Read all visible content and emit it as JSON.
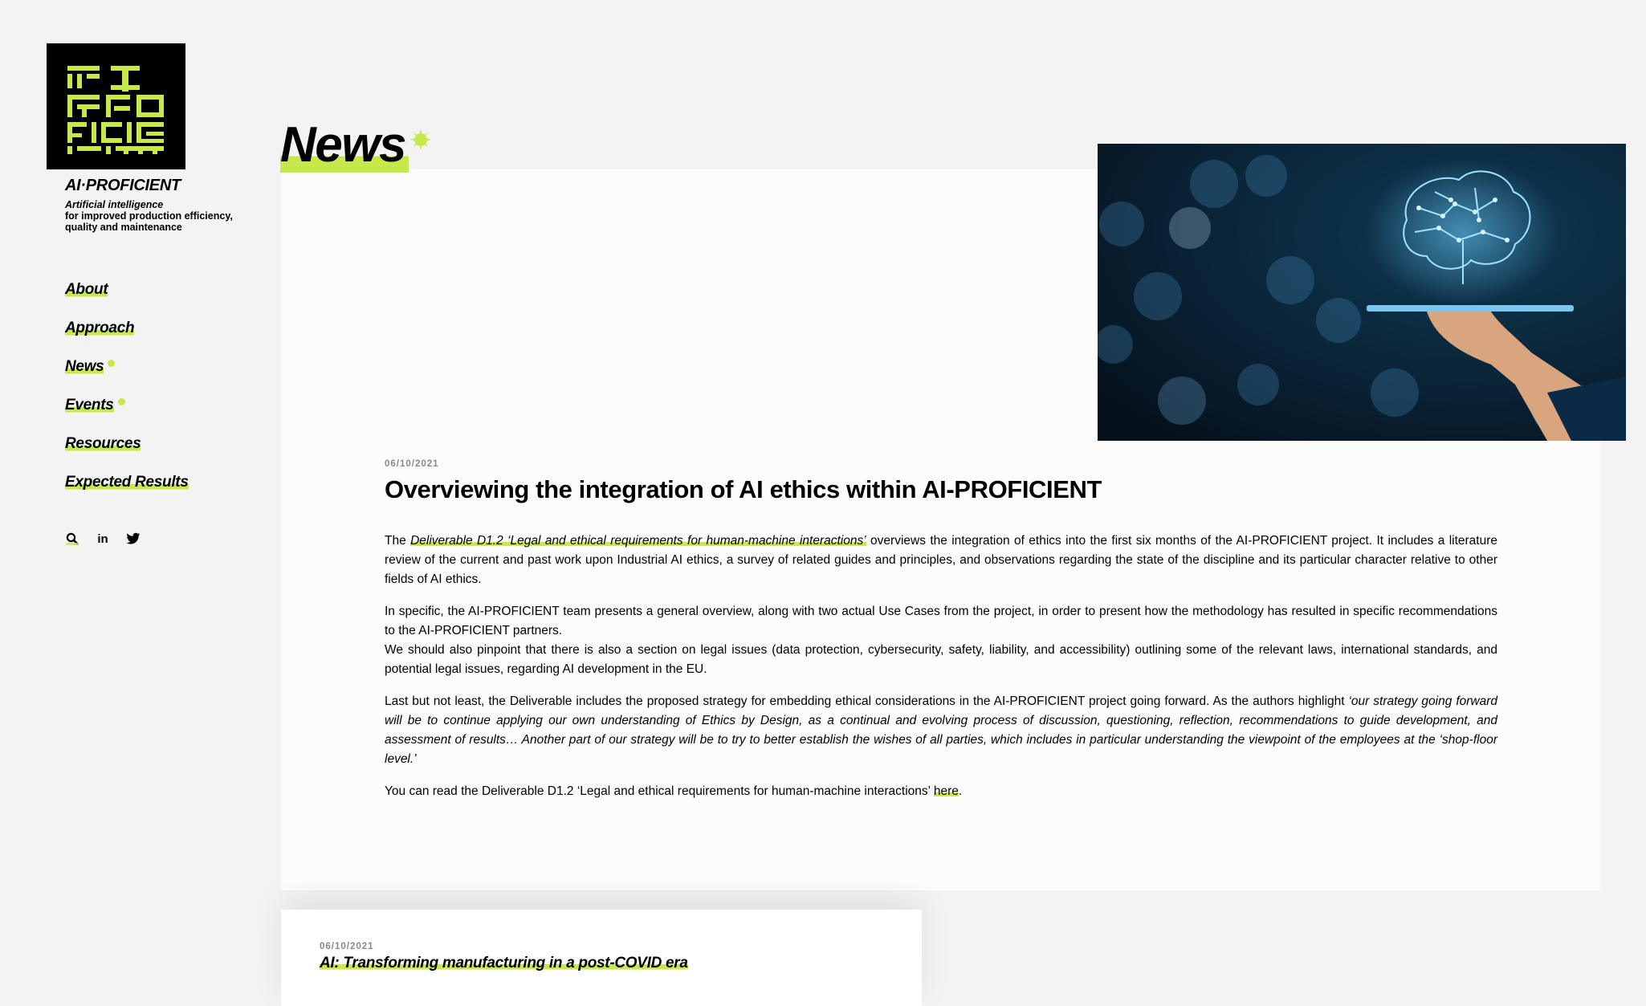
{
  "brand": {
    "name": "AI·PROFICIENT",
    "tagline_line1": "Artificial intelligence",
    "tagline_line2": "for improved production efficiency,",
    "tagline_line3": "quality and maintenance",
    "accent_color": "#c5e84a"
  },
  "nav": {
    "items": [
      {
        "label": "About"
      },
      {
        "label": "Approach"
      },
      {
        "label": "News"
      },
      {
        "label": "Events"
      },
      {
        "label": "Resources"
      },
      {
        "label": "Expected Results"
      }
    ]
  },
  "social": {
    "icons": [
      "search-icon",
      "linkedin-icon",
      "twitter-icon"
    ],
    "linkedin_label": "in"
  },
  "page": {
    "heading": "News"
  },
  "article": {
    "date": "06/10/2021",
    "title": "Overviewing the integration of AI ethics within AI-PROFICIENT",
    "p1_pre": "The ",
    "p1_link": "Deliverable D1.2 ‘Legal and ethical requirements for human-machine interactions’",
    "p1_post": " overviews the integration of ethics into the first six months of the AI-PROFICIENT project. It includes a literature review of the current and past work upon Industrial AI ethics, a survey of related guides and principles, and observations regarding the state of the discipline and its particular character relative to other fields of AI ethics.",
    "p2": "In specific, the AI-PROFICIENT team presents a general overview, along with two actual Use Cases from the project, in order to present how the methodology has resulted in specific recommendations to the AI-PROFICIENT partners.",
    "p3": "We should also pinpoint that there is also a section on legal issues (data protection, cybersecurity, safety, liability, and accessibility) outlining some of the relevant laws, international standards, and potential legal issues, regarding AI development in the EU.",
    "p4_pre": "Last but not least, the Deliverable includes the proposed strategy for embedding ethical considerations in the AI-PROFICIENT project going forward. As the authors highlight ",
    "p4_quote": "‘our strategy going forward will be to continue applying our own understanding of Ethics by Design, as a continual and evolving process of discussion, questioning, reflection, recommendations to guide development, and assessment of results… Another part of our strategy will be to try to better establish the wishes of all parties, which includes in particular understanding the viewpoint of the employees at the ‘shop-floor level.’",
    "p5_pre": "You can read the Deliverable D1.2 ‘Legal and ethical requirements for human-machine interactions’ ",
    "p5_link": "here",
    "p5_post": "."
  },
  "next_article": {
    "date": "06/10/2021",
    "title": "AI: Transforming manufacturing in a post-COVID era"
  }
}
